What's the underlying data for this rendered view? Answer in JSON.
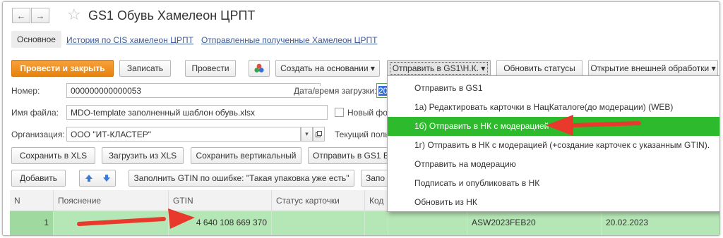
{
  "window": {
    "title": "GS1 Обувь Хамелеон ЦРПТ",
    "back_glyph": "←",
    "forward_glyph": "→",
    "favorite_glyph": "☆"
  },
  "tabs": [
    {
      "label": "Основное"
    },
    {
      "label": "История по CIS хамелеон ЦРПТ"
    },
    {
      "label": "Отправленные полученные Хамелеон ЦРПТ"
    }
  ],
  "toolbar": {
    "post_close": "Провести и закрыть",
    "write": "Записать",
    "post": "Провести",
    "create_based": "Создать на основании",
    "send_gs1": "Отправить в GS1\\Н.К.",
    "update_statuses": "Обновить статусы",
    "external": "Открытие внешней обработки",
    "dropdown_glyph": "▾"
  },
  "form": {
    "number_label": "Номер:",
    "number_value": "000000000000053",
    "load_date_label": "Дата/время загрузки:",
    "load_date_value": "20",
    "filename_label": "Имя файла:",
    "filename_value": "MDO-template заполненный шаблон обувь.xlsx",
    "new_format_label": "Новый фо",
    "org_label": "Организация:",
    "org_value": "ООО \"ИТ-КЛАСТЕР\"",
    "current_user_label": "Текущий польз"
  },
  "actions": {
    "save_xls": "Сохранить в XLS",
    "load_xls": "Загрузить из XLS",
    "save_vertical": "Сохранить вертикальный",
    "send_gs1_cut": "Отправить в GS1 E",
    "add": "Добавить",
    "fill_gtin": "Заполнить GTIN по ошибке: \"Такая упаковка уже есть\"",
    "fill_cut": "Запо"
  },
  "table": {
    "headers": [
      "N",
      "Пояснение",
      "GTIN",
      "Статус карточки",
      "Код"
    ],
    "rows": [
      {
        "n": "1",
        "note": "",
        "gtin": "4 640 108 669 370",
        "status": "",
        "code": "",
        "article": "ASW2023FEB20",
        "date": "20.02.2023"
      }
    ]
  },
  "menu": {
    "items": [
      {
        "label": "Отправить в GS1",
        "highlight": false
      },
      {
        "label": "1а) Редактировать карточки в НацКаталоге(до модерации) (WEB)",
        "highlight": false
      },
      {
        "label": "1б) Отправить в НК с модерацией",
        "highlight": true
      },
      {
        "label": "1г) Отправить в НК с модерацией (+создание карточек с указанным GTIN).",
        "highlight": false
      },
      {
        "label": "Отправить на модерацию",
        "highlight": false
      },
      {
        "label": "Подписать и опубликовать в НК",
        "highlight": false
      },
      {
        "label": "Обновить из НК",
        "highlight": false
      }
    ]
  },
  "colors": {
    "accent_orange": "#f09a2c",
    "highlight_green": "#2dbb2d",
    "row_green": "#b5e6b5",
    "annotation_red": "#e8392c",
    "link_blue": "#3e5b9b"
  }
}
